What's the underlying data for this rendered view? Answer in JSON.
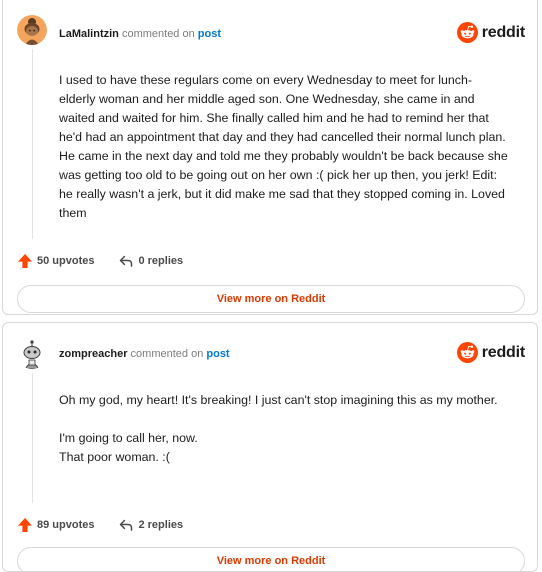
{
  "comments": [
    {
      "username": "LaMalintzin",
      "commented_on_text": "commented on",
      "post_link": "post",
      "logo_text": "reddit",
      "paragraphs": [
        "I used to have these regulars come on every Wednesday to meet for lunch- elderly woman and her middle aged son. One Wednesday, she came in and waited and waited for him. She finally called him and he had to remind her that he'd had an appointment that day and they had cancelled their normal lunch plan. He came in the next day and told me they probably wouldn't be back because she was getting too old to be going out on her own :( pick her up then, you jerk! Edit: he really wasn't a jerk, but it did make me sad that they stopped coming in. Loved them"
      ],
      "upvotes": "50 upvotes",
      "replies": "0 replies",
      "view_more": "View more on Reddit",
      "avatar_icon": "snoo-avatar-bun-hair-icon"
    },
    {
      "username": "zompreacher",
      "commented_on_text": "commented on",
      "post_link": "post",
      "logo_text": "reddit",
      "paragraphs": [
        "Oh my god, my heart! It's breaking! I just can't stop imagining this as my mother.",
        "I'm going to call her, now.\nThat poor woman. :("
      ],
      "upvotes": "89 upvotes",
      "replies": "2 replies",
      "view_more": "View more on Reddit",
      "avatar_icon": "snoo-avatar-gray-icon"
    }
  ],
  "colors": {
    "upvote_arrow": "#ff4500",
    "reddit_orange": "#ff4500",
    "link_blue": "#0079d3",
    "view_more_text": "#d93a00"
  }
}
